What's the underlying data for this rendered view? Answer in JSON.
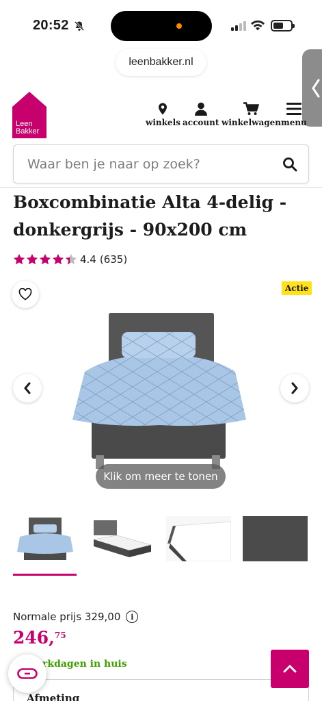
{
  "status_bar": {
    "time": "20:52"
  },
  "browser": {
    "url": "leenbakker.nl"
  },
  "header": {
    "logo_line1": "Leen",
    "logo_line2": "Bakker",
    "nav": [
      {
        "label": "winkels",
        "icon": "location-pin-icon"
      },
      {
        "label": "account",
        "icon": "user-icon"
      },
      {
        "label": "winkelwagen",
        "icon": "cart-icon"
      },
      {
        "label": "menu",
        "icon": "hamburger-icon"
      }
    ]
  },
  "search": {
    "placeholder": "Waar ben je naar op zoek?"
  },
  "product": {
    "title": "Boxcombinatie Alta 4-delig - donkergrijs - 90x200 cm",
    "rating_value": "4.4",
    "rating_count": "(635)",
    "rating_stars": 4.4,
    "badge": "Actie",
    "gallery_hint": "Klik om meer te tonen",
    "old_price_label": "Normale prijs 329,00",
    "price_main": "246,",
    "price_cents": "75",
    "delivery_text": "rkdagen in huis",
    "size_label": "Afmeting"
  },
  "colors": {
    "brand": "#c8006e",
    "badge": "#ffe21a",
    "delivery": "#40a000",
    "bed_grey": "#4a4a4a",
    "duvet_blue": "#a9c6e6"
  }
}
